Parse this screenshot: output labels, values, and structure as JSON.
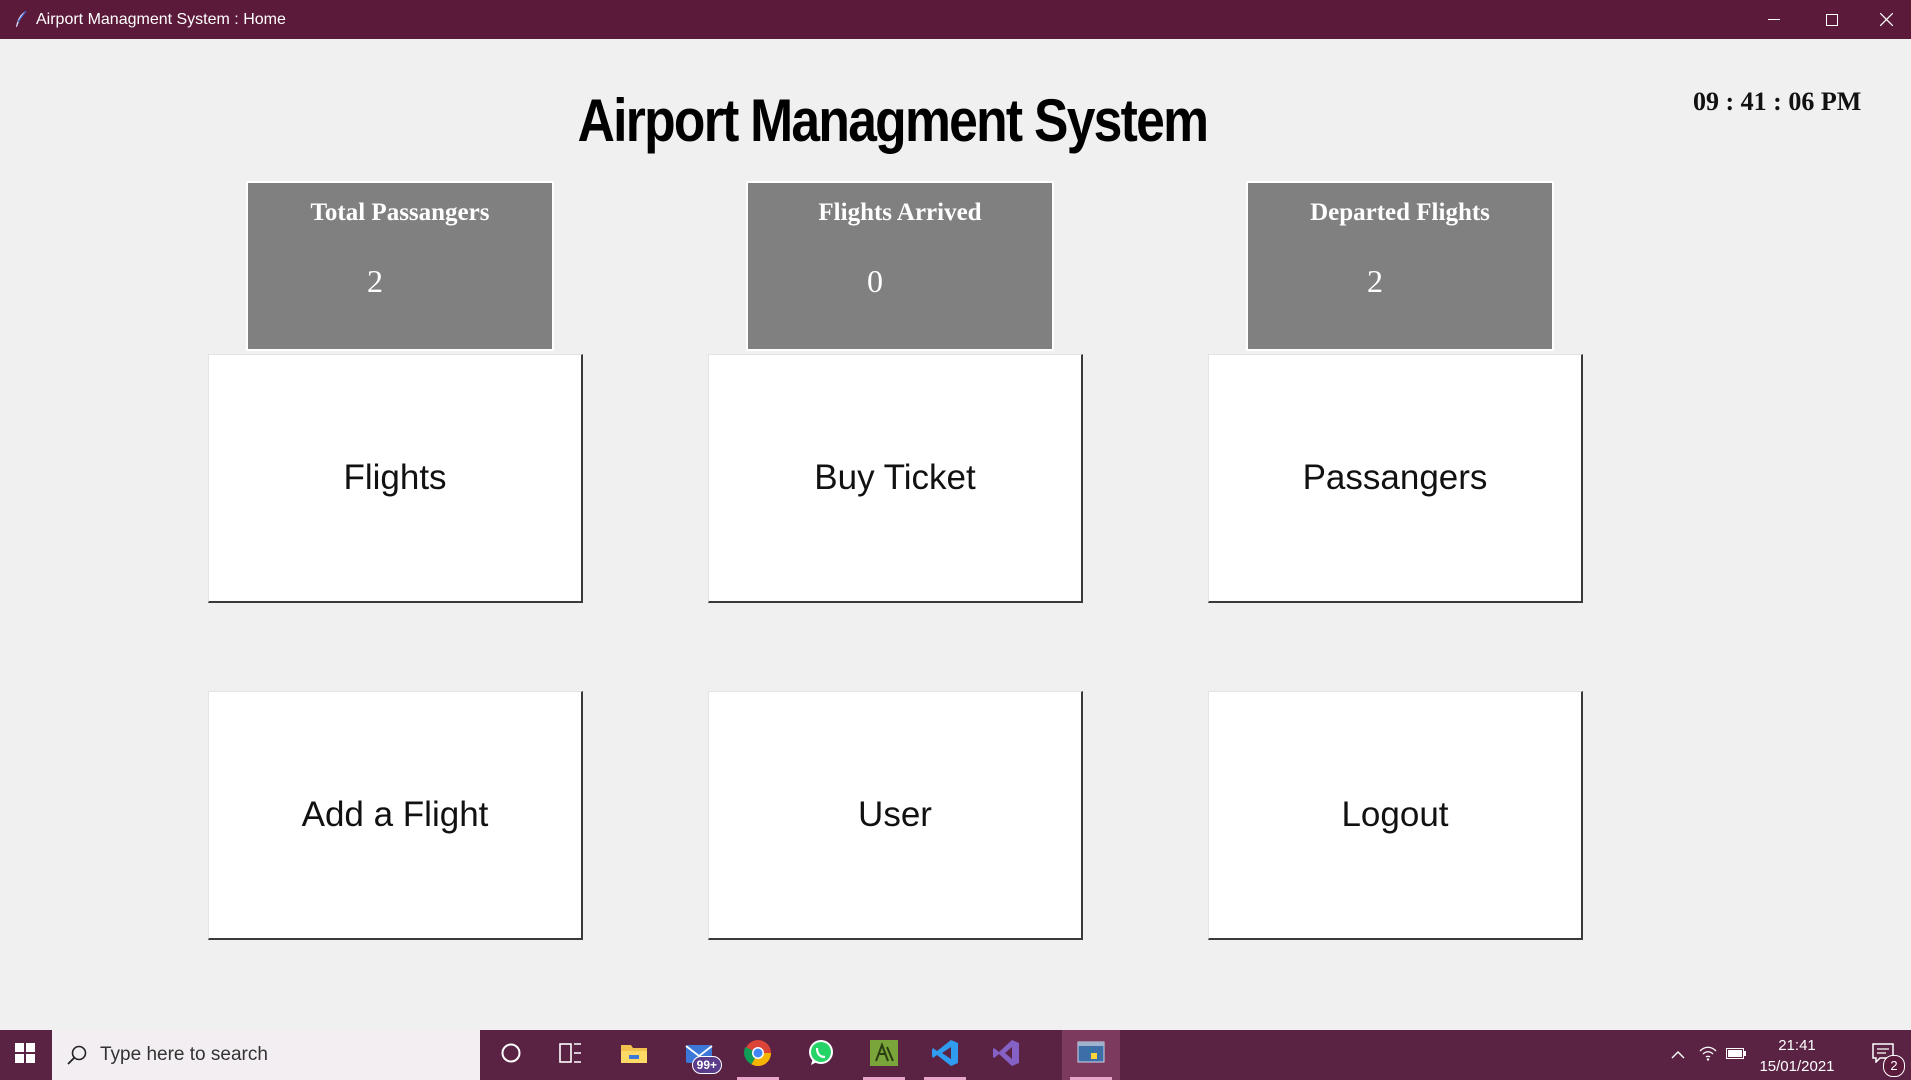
{
  "window": {
    "title": "Airport Managment System : Home",
    "minimize_icon": "minimize-icon",
    "maximize_icon": "maximize-icon",
    "close_icon": "close-icon"
  },
  "app": {
    "title": "Airport Managment System",
    "clock": "09 : 41 : 06 PM"
  },
  "stats": [
    {
      "label": "Total Passangers",
      "value": "2"
    },
    {
      "label": "Flights Arrived",
      "value": "0"
    },
    {
      "label": "Departed Flights",
      "value": "2"
    }
  ],
  "tiles": [
    {
      "label": "Flights"
    },
    {
      "label": "Buy Ticket"
    },
    {
      "label": "Passangers"
    },
    {
      "label": "Add a Flight"
    },
    {
      "label": "User"
    },
    {
      "label": "Logout"
    }
  ],
  "taskbar": {
    "search_placeholder": "Type here to search",
    "mail_badge": "99+",
    "time": "21:41",
    "date": "15/01/2021",
    "notification_count": "2",
    "apps": [
      "cortana-icon",
      "task-view-icon",
      "file-explorer-icon",
      "mail-icon",
      "chrome-icon",
      "whatsapp-icon",
      "sublime-icon",
      "vscode-icon",
      "visual-studio-icon",
      "python-icon"
    ]
  },
  "colors": {
    "titlebar": "#5c1a3b",
    "taskbar": "#5a2343",
    "stat_card": "#808080",
    "background": "#f0f0f0"
  }
}
